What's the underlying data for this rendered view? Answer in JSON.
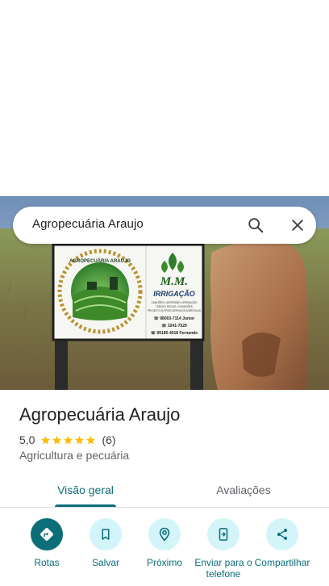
{
  "search": {
    "query": "Agropecuária Araujo"
  },
  "photo": {
    "sign_logo_text": "AGROPECUÁRIA ARAUJO",
    "sign_brand": "M.M.",
    "sign_brand_sub": "IRRIGAÇÃO",
    "sign_small_lines": [
      "CANHÕES • ASPERSÃO • IRRIGAÇÃO",
      "TUBOS • PEÇAS • CONEXÕES",
      "PROJETO OUTROS SERVIÇOS AGRÍCOLAS",
      "☏ 98003-7114 Junior",
      "☏ 3241-7529",
      "☏ 99185-4018 Fernando"
    ]
  },
  "place": {
    "name": "Agropecuária Araujo",
    "rating": "5,0",
    "stars": 5,
    "review_count": "(6)",
    "category": "Agricultura e pecuária"
  },
  "tabs": [
    {
      "label": "Visão geral",
      "active": true
    },
    {
      "label": "Avaliações",
      "active": false
    }
  ],
  "actions": [
    {
      "label": "Rotas",
      "icon": "directions-icon"
    },
    {
      "label": "Salvar",
      "icon": "bookmark-icon"
    },
    {
      "label": "Próximo",
      "icon": "nearby-icon"
    },
    {
      "label": "Enviar para o telefone",
      "icon": "send-to-phone-icon"
    },
    {
      "label": "Compartilhar",
      "icon": "share-icon"
    }
  ],
  "colors": {
    "accent": "#0b6e79",
    "accent_light": "#d3f5fa",
    "star": "#fbbc04"
  }
}
